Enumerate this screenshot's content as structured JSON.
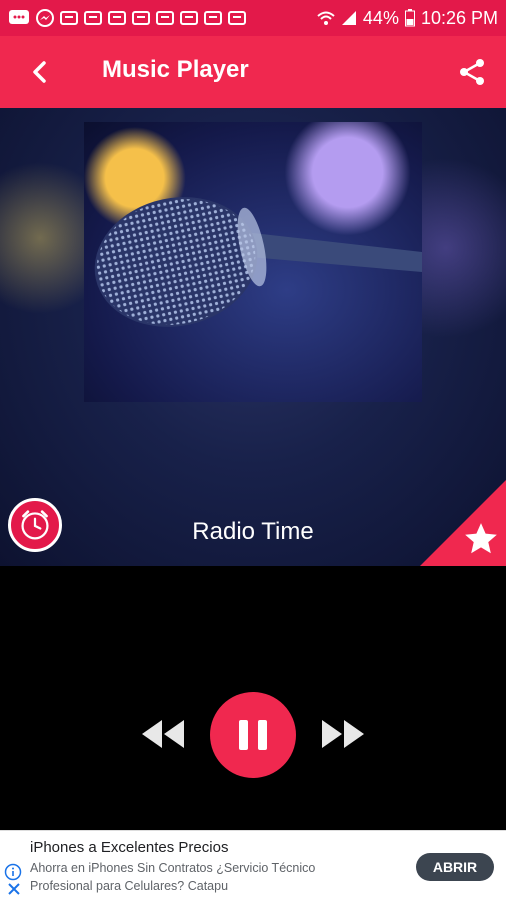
{
  "status_bar": {
    "battery": "44%",
    "time": "10:26 PM"
  },
  "app_bar": {
    "title": "Music Player"
  },
  "player": {
    "station_name": "Radio Time"
  },
  "ad": {
    "title": "iPhones a Excelentes Precios",
    "description": "Ahorra en iPhones Sin Contratos ¿Servicio Técnico Profesional para Celulares? Catapu",
    "cta": "ABRIR"
  },
  "colors": {
    "accent": "#f0284f",
    "status_bar": "#e3194a",
    "ad_button": "#3c4550"
  },
  "icons": {
    "back": "arrow-left-icon",
    "share": "share-icon",
    "timer": "alarm-clock-icon",
    "favorite": "star-icon",
    "rewind": "rewind-icon",
    "pause": "pause-icon",
    "forward": "fast-forward-icon",
    "ad_info": "info-icon",
    "ad_close": "close-icon"
  }
}
